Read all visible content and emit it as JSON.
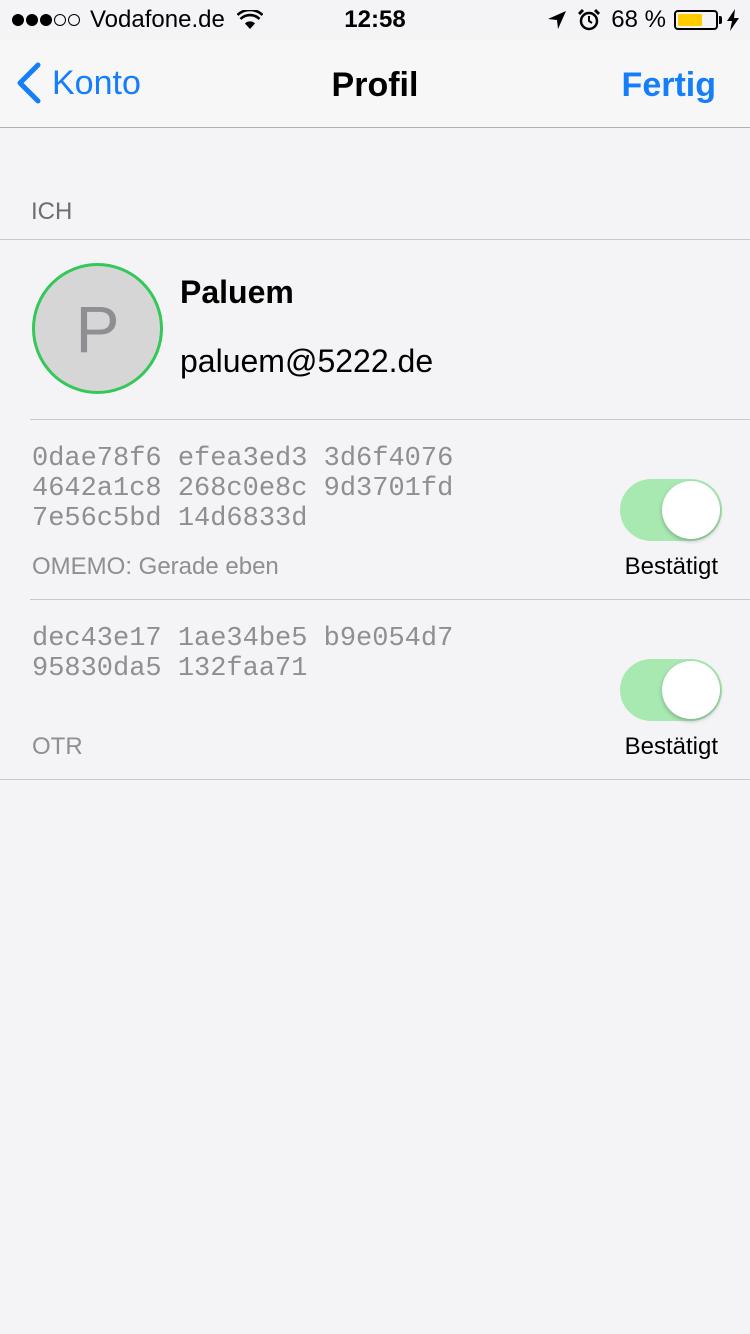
{
  "status_bar": {
    "carrier": "Vodafone.de",
    "time": "12:58",
    "battery_percent": "68 %",
    "battery_level": 0.68,
    "signal_bars_filled": 3,
    "signal_bars_total": 5
  },
  "nav": {
    "back_label": "Konto",
    "title": "Profil",
    "done_label": "Fertig"
  },
  "section": {
    "header": "ICH",
    "profile": {
      "avatar_letter": "P",
      "name": "Paluem",
      "jid": "paluem@5222.de"
    },
    "fingerprints": [
      {
        "text": "0dae78f6 efea3ed3 3d6f4076\n4642a1c8 268c0e8c 9d3701fd\n7e56c5bd 14d6833d",
        "label": "OMEMO: Gerade eben",
        "verified_label": "Bestätigt",
        "verified": true
      },
      {
        "text": "dec43e17 1ae34be5 b9e054d7\n95830da5 132faa71",
        "label": "OTR",
        "verified_label": "Bestätigt",
        "verified": true
      }
    ]
  },
  "colors": {
    "accent": "#147efb",
    "avatar_ring": "#34c759",
    "toggle_on": "#a7e9b1",
    "battery": "#ffcc00"
  }
}
